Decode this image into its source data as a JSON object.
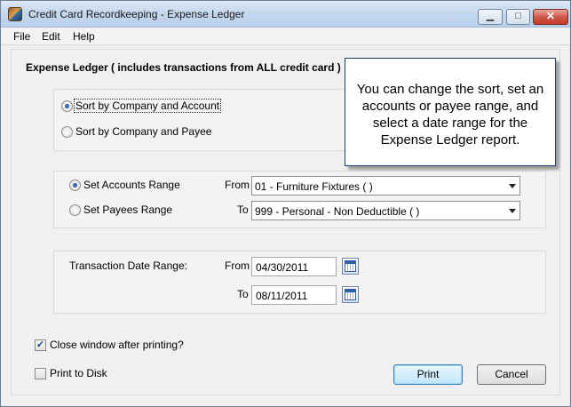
{
  "window": {
    "title": "Credit Card Recordkeeping - Expense Ledger",
    "minimize_glyph": "▁",
    "maximize_glyph": "□",
    "close_glyph": "✕"
  },
  "menu": [
    "File",
    "Edit",
    "Help"
  ],
  "heading": "Expense Ledger ( includes transactions from ALL credit card )",
  "sort": {
    "options": [
      "Sort by Company and Account",
      "Sort by Company and Payee"
    ],
    "selected_index": 0
  },
  "range": {
    "options": [
      "Set Accounts Range",
      "Set Payees Range"
    ],
    "selected_index": 0,
    "from_label": "From",
    "to_label": "To",
    "from_value": "01 - Furniture  Fixtures (  )",
    "to_value": "999 - Personal - Non Deductible (  )"
  },
  "dates": {
    "label": "Transaction Date Range:",
    "from_label": "From",
    "to_label": "To",
    "from_value": "04/30/2011",
    "to_value": "08/11/2011"
  },
  "options": {
    "close_after_printing": {
      "label": "Close window after printing?",
      "checked": true
    },
    "print_to_disk": {
      "label": "Print to Disk",
      "checked": false
    }
  },
  "buttons": {
    "print": "Print",
    "cancel": "Cancel"
  },
  "callout": "You can change the sort, set an accounts or payee range, and select a date range for the Expense Ledger report.",
  "check_glyph": "✓"
}
